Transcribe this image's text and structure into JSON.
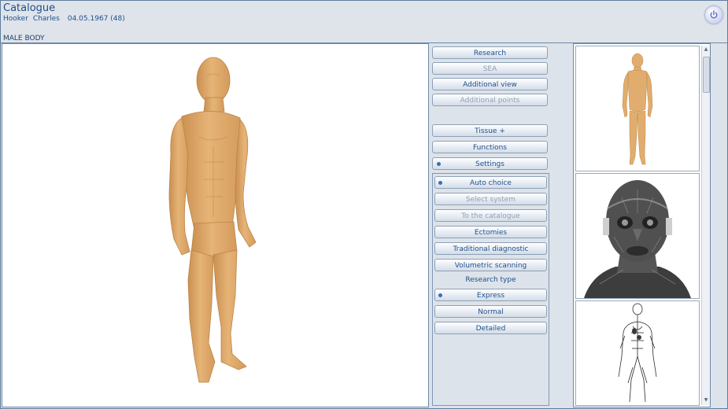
{
  "header": {
    "title": "Catalogue",
    "patient_last": "Hooker",
    "patient_first": "Charles",
    "birth": "04.05.1967 (48)",
    "section": "MALE BODY",
    "power_icon": "power-icon"
  },
  "panel": {
    "research": "Research",
    "sea": "SEA",
    "additional_view": "Additional view",
    "additional_points": "Additional points",
    "tissue": "Tissue +",
    "functions": "Functions",
    "settings": "Settings"
  },
  "subpanel": {
    "auto_choice": "Auto choice",
    "select_system": "Select system",
    "to_catalogue": "To the catalogue",
    "ectomies": "Ectomies",
    "traditional": "Traditional diagnostic",
    "volumetric": "Volumetric scanning",
    "research_type_title": "Research type",
    "express": "Express",
    "normal": "Normal",
    "detailed": "Detailed"
  },
  "colors": {
    "accent": "#1f4f8c",
    "skin": "#e1ad6e",
    "border": "#6d8aa8"
  }
}
